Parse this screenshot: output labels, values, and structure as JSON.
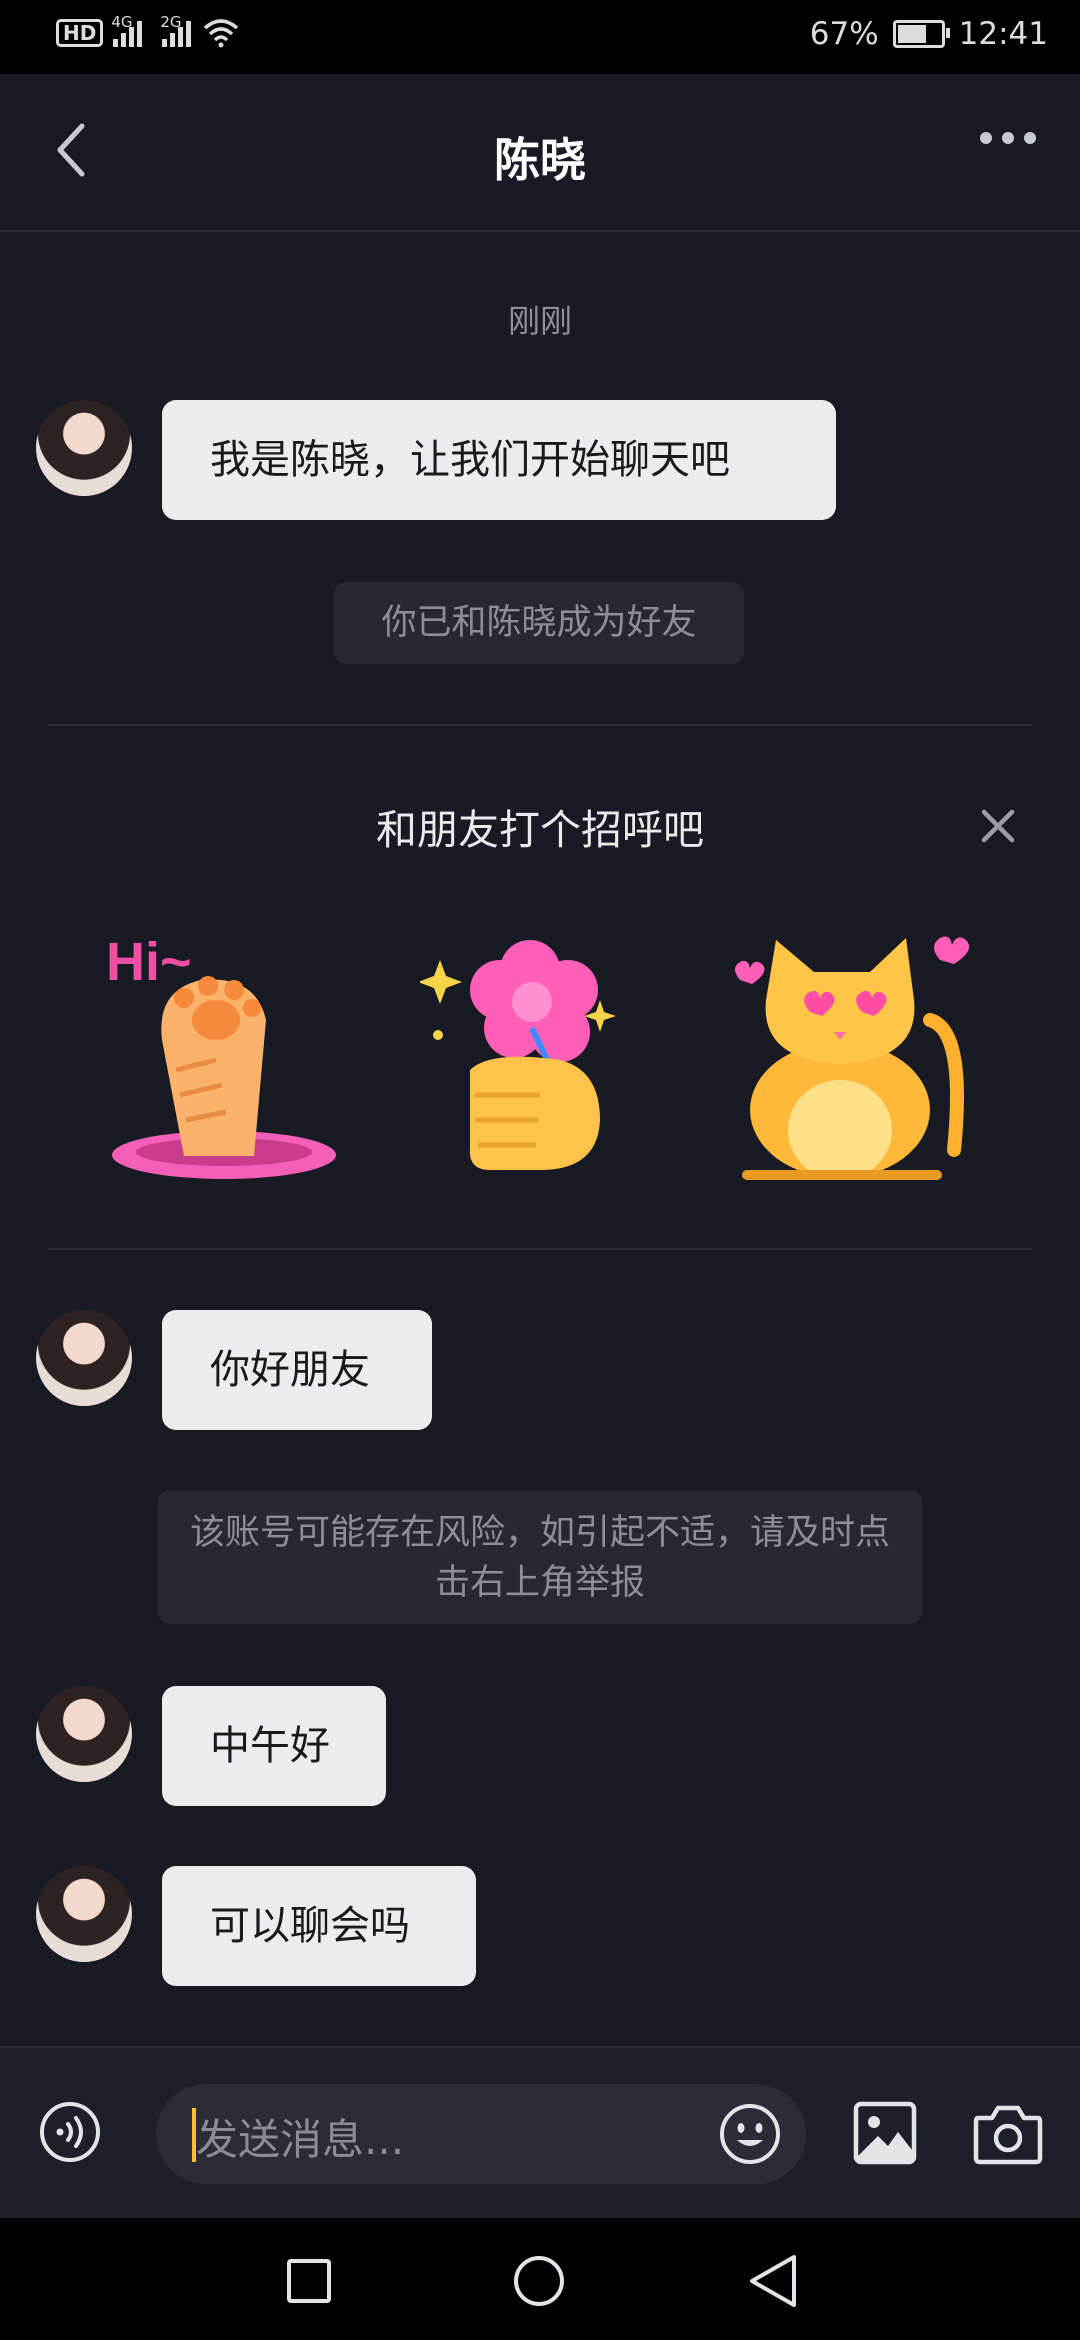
{
  "status_bar": {
    "hd": "HD",
    "sim1_net": "4G",
    "sim2_net": "2G",
    "battery": "67%",
    "time": "12:41"
  },
  "header": {
    "title": "陈晓"
  },
  "chat": {
    "timestamp": "刚刚",
    "message_1": "我是陈晓，让我们开始聊天吧",
    "friend_notice": "你已和陈晓成为好友",
    "greet_title": "和朋友打个招呼吧",
    "sticker_hi_text": "Hi~",
    "message_2": "你好朋友",
    "risk_notice": "该账号可能存在风险，如引起不适，请及时点击右上角举报",
    "message_3": "中午好",
    "message_4": "可以聊会吗"
  },
  "input": {
    "placeholder": "发送消息..."
  },
  "icons": {
    "back": "chevron-left-icon",
    "more": "more-dots-icon",
    "close": "close-icon",
    "voice": "voice-icon",
    "emoji": "emoji-icon",
    "image": "image-icon",
    "camera": "camera-icon"
  },
  "colors": {
    "background": "#181a24",
    "bubble": "#ececee",
    "system_box": "#262832",
    "cursor": "#f7c02e"
  }
}
